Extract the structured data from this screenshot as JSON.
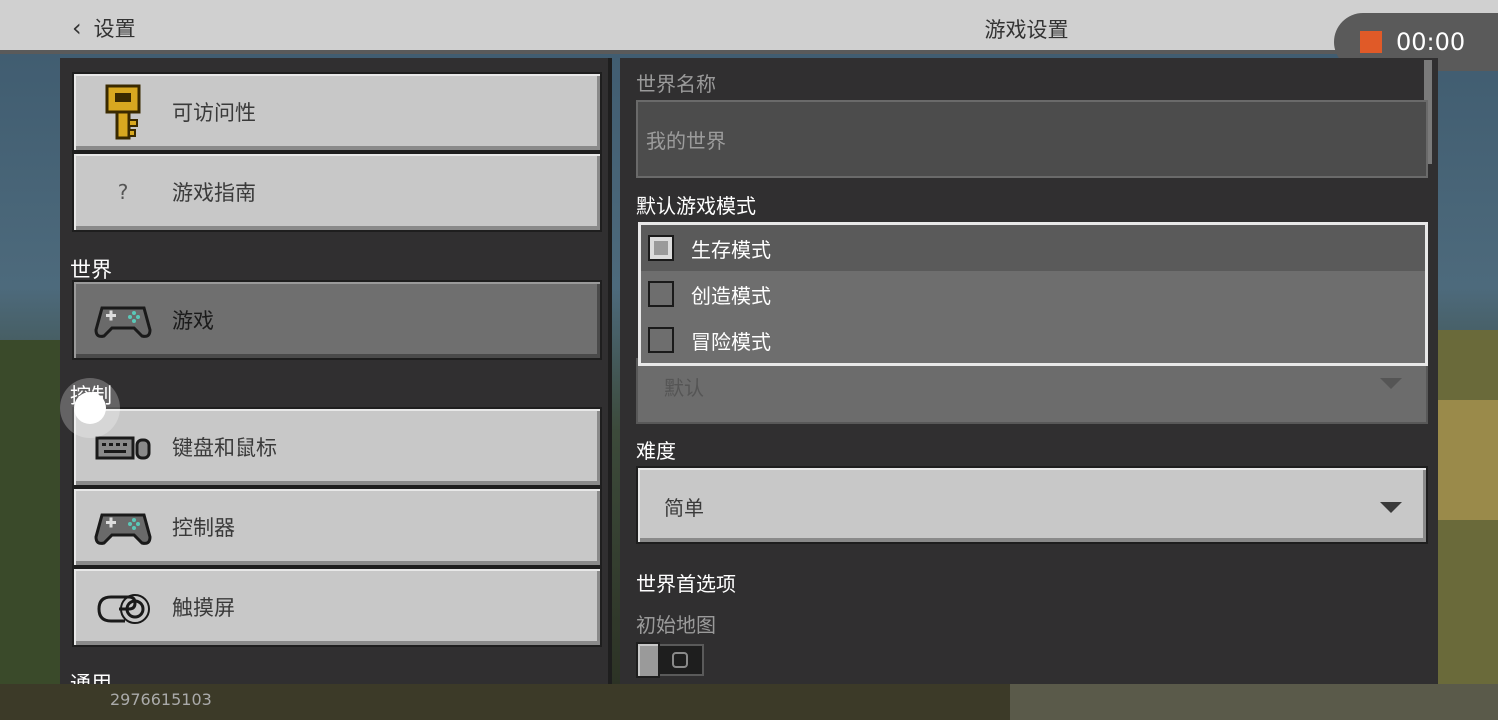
{
  "header": {
    "back_label": "设置",
    "title": "游戏设置"
  },
  "recording": {
    "time": "00:00",
    "stop_color": "#e05a28"
  },
  "sidebar": {
    "items": [
      {
        "label": "可访问性",
        "icon": "key-icon"
      },
      {
        "label": "游戏指南",
        "icon": "question-icon"
      }
    ],
    "sections": [
      {
        "title": "世界",
        "items": [
          {
            "label": "游戏",
            "icon": "gamepad-icon",
            "active": true
          }
        ]
      },
      {
        "title": "控制",
        "items": [
          {
            "label": "键盘和鼠标",
            "icon": "keyboard-mouse-icon"
          },
          {
            "label": "控制器",
            "icon": "gamepad-icon"
          },
          {
            "label": "触摸屏",
            "icon": "touch-hand-icon"
          }
        ]
      },
      {
        "title": "通用"
      }
    ]
  },
  "main": {
    "world_name_label": "世界名称",
    "world_name_value": "我的世界",
    "default_mode_label": "默认游戏模式",
    "mode_options": [
      "生存模式",
      "创造模式",
      "冒险模式"
    ],
    "mode_selected": "默认",
    "difficulty_label": "难度",
    "difficulty_value": "简单",
    "world_prefs_label": "世界首选项",
    "starting_map_label": "初始地图"
  },
  "footer": {
    "uid": "2976615103"
  }
}
